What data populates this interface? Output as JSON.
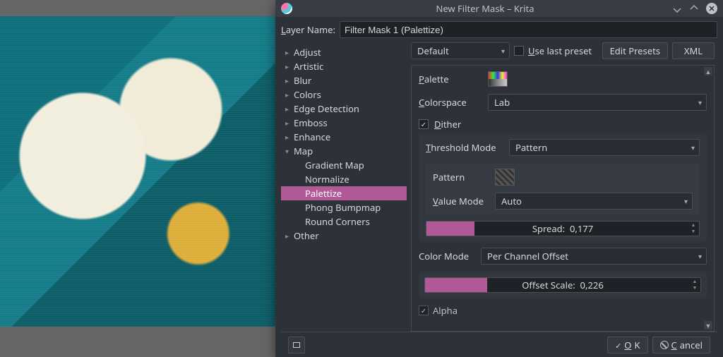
{
  "window": {
    "title": "New Filter Mask – Krita"
  },
  "layerName": {
    "label": "Layer Name:",
    "value": "Filter Mask 1 (Palettize)"
  },
  "tree": {
    "items": [
      {
        "label": "Adjust",
        "state": "collapsed"
      },
      {
        "label": "Artistic",
        "state": "collapsed"
      },
      {
        "label": "Blur",
        "state": "collapsed"
      },
      {
        "label": "Colors",
        "state": "collapsed"
      },
      {
        "label": "Edge Detection",
        "state": "collapsed"
      },
      {
        "label": "Emboss",
        "state": "collapsed"
      },
      {
        "label": "Enhance",
        "state": "collapsed"
      },
      {
        "label": "Map",
        "state": "expanded",
        "children": [
          {
            "label": "Gradient Map"
          },
          {
            "label": "Normalize"
          },
          {
            "label": "Palettize",
            "selected": true
          },
          {
            "label": "Phong Bumpmap"
          },
          {
            "label": "Round Corners"
          }
        ]
      },
      {
        "label": "Other",
        "state": "collapsed"
      }
    ]
  },
  "toolbar": {
    "preset_value": "Default",
    "use_last_label": "Use last preset",
    "use_last_checked": false,
    "edit_presets": "Edit Presets",
    "xml": "XML"
  },
  "filter": {
    "palette_label": "Palette",
    "colorspace_label": "Colorspace",
    "colorspace_value": "Lab",
    "dither_label": "Dither",
    "dither_checked": true,
    "threshold_mode_label": "Threshold Mode",
    "threshold_mode_value": "Pattern",
    "pattern_label": "Pattern",
    "value_mode_label": "Value Mode",
    "value_mode_value": "Auto",
    "spread_label": "Spread:",
    "spread_value": "0,177",
    "spread_fill_pct": 17.7,
    "color_mode_label": "Color Mode",
    "color_mode_value": "Per Channel Offset",
    "offset_scale_label": "Offset Scale:",
    "offset_scale_value": "0,226",
    "offset_scale_fill_pct": 22.6,
    "alpha_label": "Alpha",
    "alpha_checked": true
  },
  "buttons": {
    "ok": "OK",
    "cancel": "Cancel"
  }
}
